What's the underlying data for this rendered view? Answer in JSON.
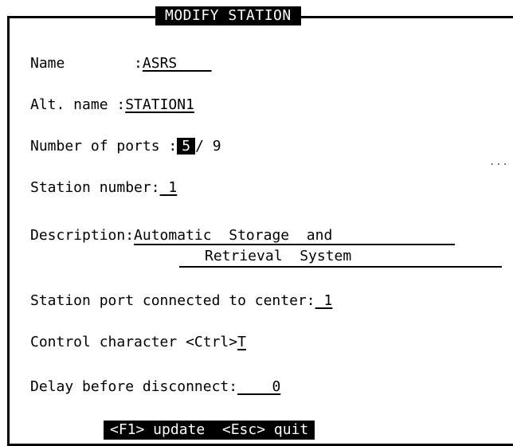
{
  "window": {
    "title": "MODIFY STATION"
  },
  "fields": {
    "name": {
      "label": "Name        :",
      "value": "ASRS    "
    },
    "alt_name": {
      "label": "Alt. name :",
      "value": "STATION1"
    },
    "ports": {
      "label": "Number of ports :",
      "value": "5",
      "max": "/ 9"
    },
    "station_number": {
      "label": "Station number:",
      "value": " 1"
    },
    "description": {
      "label": "Description:",
      "line1": "Automatic  Storage  and",
      "line2": "Retrieval  System"
    },
    "center_port": {
      "label": "Station port connected to center:",
      "value": " 1"
    },
    "control_char": {
      "label": "Control character <Ctrl>",
      "value": "T"
    },
    "delay": {
      "label": "Delay before disconnect:",
      "value": "    0"
    }
  },
  "indicators": {
    "more": "..."
  },
  "footer": {
    "hint": "<F1> update  <Esc> quit"
  }
}
